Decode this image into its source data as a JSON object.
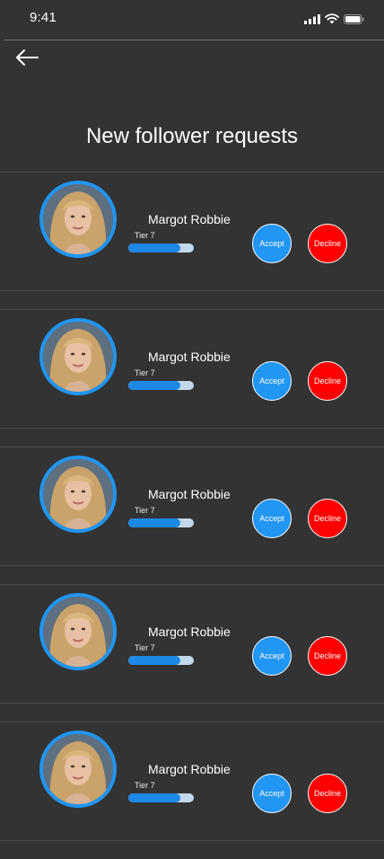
{
  "status_bar": {
    "time": "9:41",
    "icons": [
      "signal-icon",
      "wifi-icon",
      "battery-icon"
    ]
  },
  "header": {
    "back_icon": "arrow-left-icon",
    "title": "New follower requests"
  },
  "requests": [
    {
      "name": "Margot Robbie",
      "tier": "Tier 7",
      "progress": 0.8,
      "accept_label": "Accept",
      "decline_label": "Decline"
    },
    {
      "name": "Margot Robbie",
      "tier": "Tier 7",
      "progress": 0.8,
      "accept_label": "Accept",
      "decline_label": "Decline"
    },
    {
      "name": "Margot Robbie",
      "tier": "Tier 7",
      "progress": 0.8,
      "accept_label": "Accept",
      "decline_label": "Decline"
    },
    {
      "name": "Margot Robbie",
      "tier": "Tier 7",
      "progress": 0.8,
      "accept_label": "Accept",
      "decline_label": "Decline"
    },
    {
      "name": "Margot Robbie",
      "tier": "Tier 7",
      "progress": 0.8,
      "accept_label": "Accept",
      "decline_label": "Decline"
    }
  ],
  "colors": {
    "background": "#333333",
    "accent": "#2196f3",
    "accept": "#2196f3",
    "decline": "#ff0000",
    "progress_fill": "#1e88e5",
    "progress_track": "#c3d8ea"
  }
}
